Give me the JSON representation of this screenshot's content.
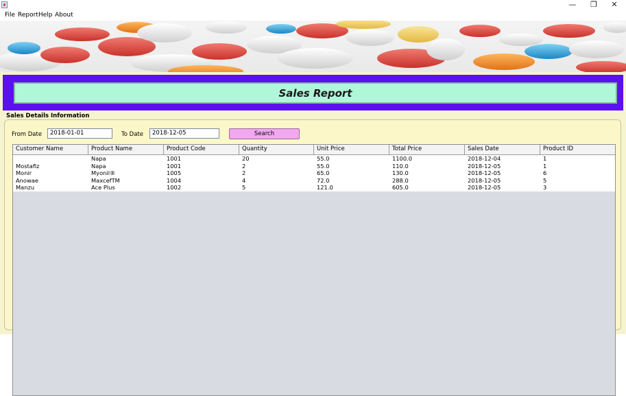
{
  "window": {
    "minimize": "—",
    "restore": "❐",
    "close": "✕"
  },
  "menu": [
    "File",
    "Report",
    "Help",
    "About"
  ],
  "header": {
    "title": "Sales Report"
  },
  "details": {
    "label": "Sales Details Information",
    "from_label": "From Date",
    "from_value": "2018-01-01",
    "to_label": "To Date",
    "to_value": "2018-12-05",
    "search_label": "Search"
  },
  "table": {
    "columns": [
      "Customer Name",
      "Product Name",
      "Product Code",
      "Quantity",
      "Unit Price",
      "Total Price",
      "Sales Date",
      "Product ID"
    ],
    "rows": [
      [
        "",
        "Napa",
        "1001",
        "20",
        "55.0",
        "1100.0",
        "2018-12-04",
        "1"
      ],
      [
        "Mostafiz",
        "Napa",
        "1001",
        "2",
        "55.0",
        "110.0",
        "2018-12-05",
        "1"
      ],
      [
        "Monir",
        "Myonil®",
        "1005",
        "2",
        "65.0",
        "130.0",
        "2018-12-05",
        "6"
      ],
      [
        "Anowae",
        "MaxcefTM",
        "1004",
        "4",
        "72.0",
        "288.0",
        "2018-12-05",
        "5"
      ],
      [
        "Manzu",
        "Ace Plus",
        "1002",
        "5",
        "121.0",
        "605.0",
        "2018-12-05",
        "3"
      ]
    ]
  },
  "colors": {
    "header_band": "#5b10ee",
    "title_box": "#b0f7d8",
    "search_button": "#f2a8f0",
    "panel": "#fbf7c9"
  }
}
